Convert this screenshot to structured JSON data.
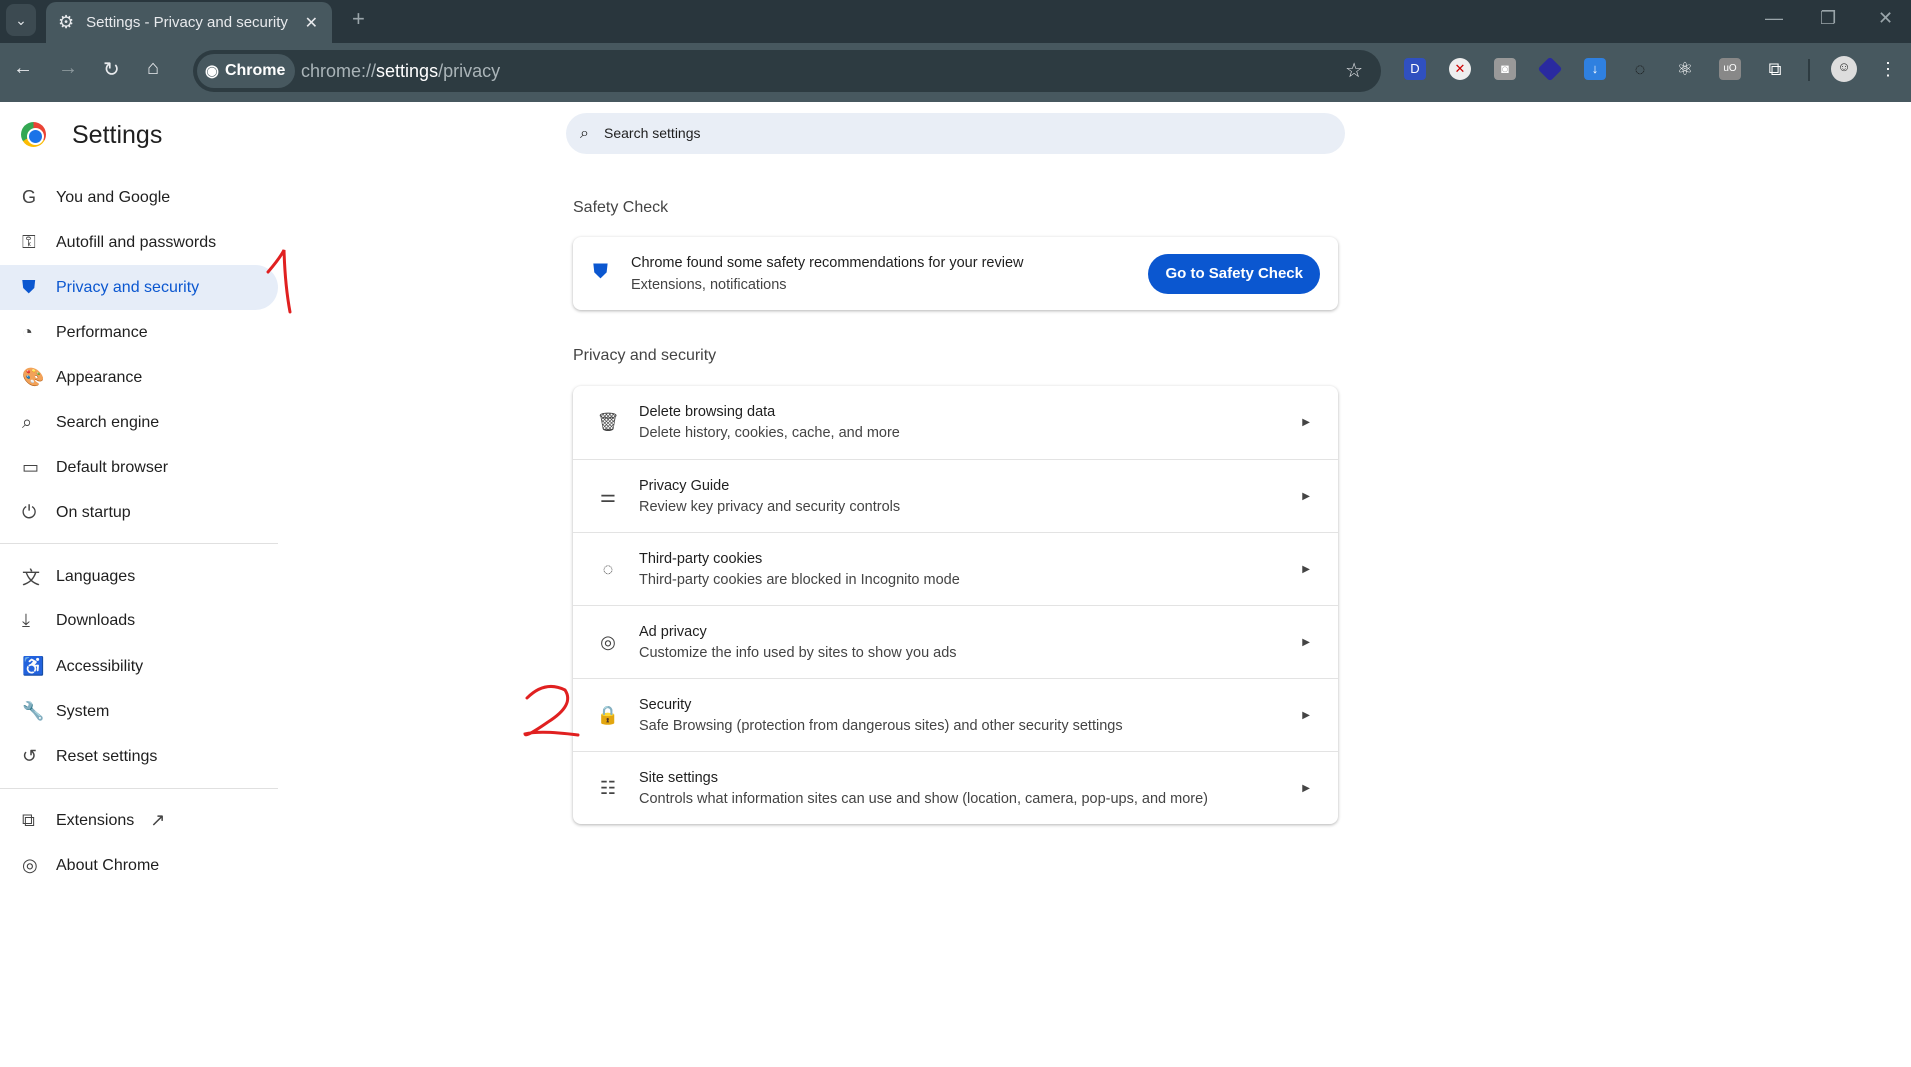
{
  "browser": {
    "tab_title": "Settings - Privacy and security",
    "chip": "Chrome",
    "url_prefix": "chrome://",
    "url_host": "settings",
    "url_path": "/privacy"
  },
  "header": {
    "title": "Settings",
    "search_placeholder": "Search settings"
  },
  "sidebar": {
    "items": [
      {
        "label": "You and Google",
        "icon": "G"
      },
      {
        "label": "Autofill and passwords",
        "icon": "⚿"
      },
      {
        "label": "Privacy and security",
        "icon": "⛊"
      },
      {
        "label": "Performance",
        "icon": "◔"
      },
      {
        "label": "Appearance",
        "icon": "🎨"
      },
      {
        "label": "Search engine",
        "icon": "⌕"
      },
      {
        "label": "Default browser",
        "icon": "▭"
      },
      {
        "label": "On startup",
        "icon": "⏻"
      },
      {
        "label": "Languages",
        "icon": "文"
      },
      {
        "label": "Downloads",
        "icon": "⤓"
      },
      {
        "label": "Accessibility",
        "icon": "♿"
      },
      {
        "label": "System",
        "icon": "🔧"
      },
      {
        "label": "Reset settings",
        "icon": "↺"
      },
      {
        "label": "Extensions",
        "icon": "⧉"
      },
      {
        "label": "About Chrome",
        "icon": "◎"
      }
    ]
  },
  "safety": {
    "label": "Safety Check",
    "title": "Chrome found some safety recommendations for your review",
    "subtitle": "Extensions, notifications",
    "button": "Go to Safety Check"
  },
  "privacy": {
    "label": "Privacy and security",
    "rows": [
      {
        "title": "Delete browsing data",
        "subtitle": "Delete history, cookies, cache, and more",
        "icon": "🗑"
      },
      {
        "title": "Privacy Guide",
        "subtitle": "Review key privacy and security controls",
        "icon": "⚌"
      },
      {
        "title": "Third-party cookies",
        "subtitle": "Third-party cookies are blocked in Incognito mode",
        "icon": "◌"
      },
      {
        "title": "Ad privacy",
        "subtitle": "Customize the info used by sites to show you ads",
        "icon": "◎"
      },
      {
        "title": "Security",
        "subtitle": "Safe Browsing (protection from dangerous sites) and other security settings",
        "icon": "🔒"
      },
      {
        "title": "Site settings",
        "subtitle": "Controls what information sites can use and show (location, camera, pop-ups, and more)",
        "icon": "☷"
      }
    ]
  },
  "annotations": {
    "one": "1",
    "two": "2",
    "color": "#e02020"
  }
}
